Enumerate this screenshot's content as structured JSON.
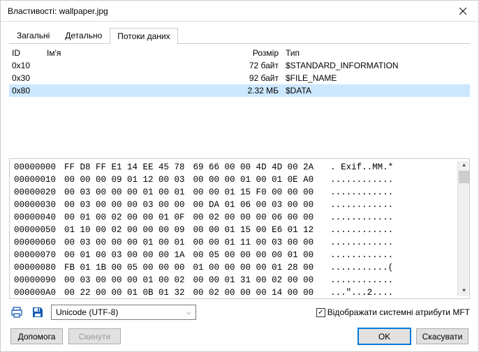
{
  "window": {
    "title": "Властивості: wallpaper.jpg"
  },
  "tabs": {
    "general": "Загальні",
    "detailed": "Детально",
    "streams": "Потоки даних"
  },
  "table": {
    "headers": {
      "id": "ID",
      "name": "Ім'я",
      "size": "Розмір",
      "type": "Тип"
    },
    "rows": [
      {
        "id": "0x10",
        "name": "",
        "size": "72 байт",
        "type": "$STANDARD_INFORMATION"
      },
      {
        "id": "0x30",
        "name": "",
        "size": "92 байт",
        "type": "$FILE_NAME"
      },
      {
        "id": "0x80",
        "name": "",
        "size": "2.32 МБ",
        "type": "$DATA"
      }
    ]
  },
  "hex": {
    "offsets": [
      "00000000",
      "00000010",
      "00000020",
      "00000030",
      "00000040",
      "00000050",
      "00000060",
      "00000070",
      "00000080",
      "00000090",
      "000000A0"
    ],
    "bytes1": [
      "FF D8 FF E1 14 EE 45 78",
      "00 00 00 09 01 12 00 03",
      "00 03 00 00 00 01 00 01",
      "00 03 00 00 00 03 00 00",
      "00 01 00 02 00 00 01 0F",
      "01 10 00 02 00 00 00 09",
      "00 03 00 00 00 01 00 01",
      "00 01 00 03 00 00 00 1A",
      "FB 01 1B 00 05 00 00 00",
      "00 03 00 00 00 01 00 02",
      "00 22 00 00 01 0B 01 32"
    ],
    "bytes2": [
      "69 66 00 00 4D 4D 00 2A",
      "00 00 00 01 00 01 0E A0",
      "00 00 01 15 F0 00 00 00",
      "00 DA 01 06 00 03 00 00",
      "00 02 00 00 00 06 00 00",
      "00 00 01 15 00 E6 01 12",
      "00 00 01 11 00 03 00 00",
      "00 05 00 00 00 00 01 00",
      "01 00 00 00 00 01 28 00",
      "00 00 01 31 00 02 00 00",
      "00 02 00 00 00 14 00 00"
    ],
    "ascii": [
      ". Exif..MM.*",
      "............",
      "............",
      "............",
      "............",
      "............",
      "............",
      "............",
      "...........(",
      "............",
      "...\"...2...."
    ]
  },
  "bottom": {
    "encoding": "Unicode (UTF-8)",
    "mft_checkbox": "Відображати системні атрибути MFT"
  },
  "buttons": {
    "help": "Допомога",
    "reset": "Скинути",
    "ok": "OK",
    "cancel": "Скасувати"
  }
}
